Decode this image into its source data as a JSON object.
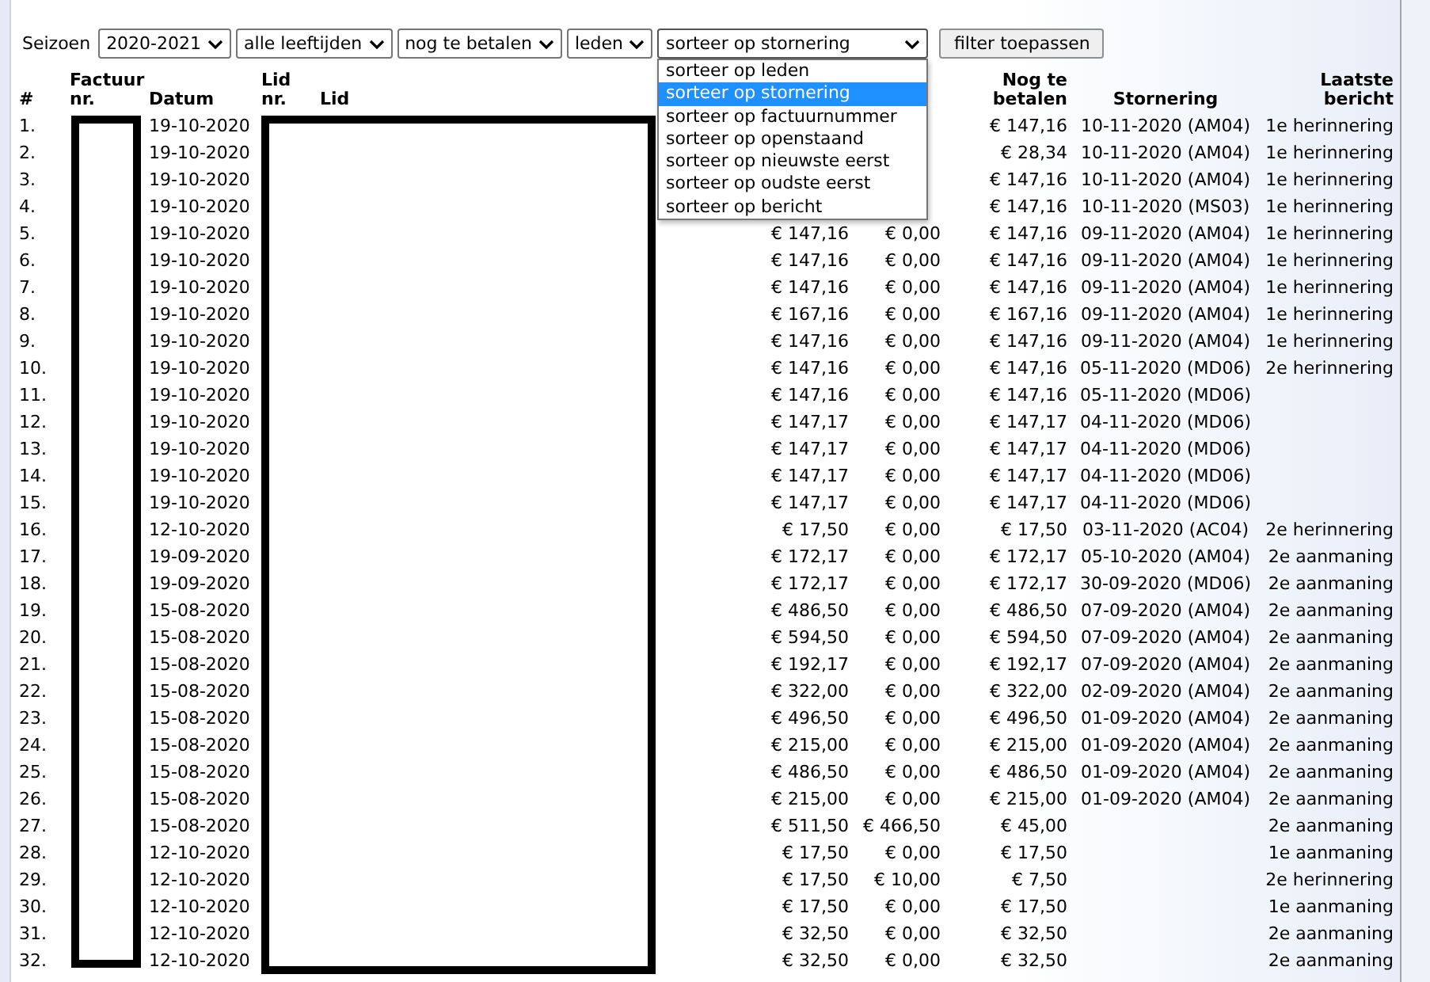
{
  "filters": {
    "label": "Seizoen",
    "selects": [
      {
        "value": "2020-2021"
      },
      {
        "value": "alle leeftijden"
      },
      {
        "value": "nog te betalen"
      },
      {
        "value": "leden"
      }
    ],
    "sort": {
      "value": "sorteer op stornering",
      "expanded": true,
      "options": [
        {
          "label": "sorteer op leden",
          "selected": false
        },
        {
          "label": "sorteer op stornering",
          "selected": true
        },
        {
          "label": "sorteer op factuurnummer",
          "selected": false
        },
        {
          "label": "sorteer op openstaand",
          "selected": false
        },
        {
          "label": "sorteer op nieuwste eerst",
          "selected": false
        },
        {
          "label": "sorteer op oudste eerst",
          "selected": false
        },
        {
          "label": "sorteer op bericht",
          "selected": false
        }
      ]
    },
    "button": "filter toepassen"
  },
  "table": {
    "columns": [
      "#",
      "Factuur nr.",
      "Datum",
      "Lid nr.",
      "Lid",
      "Nog te betalen",
      "Stornering",
      "Laatste bericht"
    ],
    "rows": [
      {
        "n": "1.",
        "date": "19-10-2020",
        "due": "€ 147,16",
        "storno": "10-11-2020 (AM04)",
        "message": "1e herinnering"
      },
      {
        "n": "2.",
        "date": "19-10-2020",
        "due": "€ 28,34",
        "storno": "10-11-2020 (AM04)",
        "message": "1e herinnering"
      },
      {
        "n": "3.",
        "date": "19-10-2020",
        "due": "€ 147,16",
        "storno": "10-11-2020 (AM04)",
        "message": "1e herinnering"
      },
      {
        "n": "4.",
        "date": "19-10-2020",
        "due": "€ 147,16",
        "storno": "10-11-2020 (MS03)",
        "message": "1e herinnering"
      },
      {
        "n": "5.",
        "date": "19-10-2020",
        "amount": "€ 147,16",
        "paid": "€ 0,00",
        "due": "€ 147,16",
        "storno": "09-11-2020 (AM04)",
        "message": "1e herinnering"
      },
      {
        "n": "6.",
        "date": "19-10-2020",
        "amount": "€ 147,16",
        "paid": "€ 0,00",
        "due": "€ 147,16",
        "storno": "09-11-2020 (AM04)",
        "message": "1e herinnering"
      },
      {
        "n": "7.",
        "date": "19-10-2020",
        "amount": "€ 147,16",
        "paid": "€ 0,00",
        "due": "€ 147,16",
        "storno": "09-11-2020 (AM04)",
        "message": "1e herinnering"
      },
      {
        "n": "8.",
        "date": "19-10-2020",
        "amount": "€ 167,16",
        "paid": "€ 0,00",
        "due": "€ 167,16",
        "storno": "09-11-2020 (AM04)",
        "message": "1e herinnering"
      },
      {
        "n": "9.",
        "date": "19-10-2020",
        "amount": "€ 147,16",
        "paid": "€ 0,00",
        "due": "€ 147,16",
        "storno": "09-11-2020 (AM04)",
        "message": "1e herinnering"
      },
      {
        "n": "10.",
        "date": "19-10-2020",
        "amount": "€ 147,16",
        "paid": "€ 0,00",
        "due": "€ 147,16",
        "storno": "05-11-2020 (MD06)",
        "message": "2e herinnering"
      },
      {
        "n": "11.",
        "date": "19-10-2020",
        "amount": "€ 147,16",
        "paid": "€ 0,00",
        "due": "€ 147,16",
        "storno": "05-11-2020 (MD06)"
      },
      {
        "n": "12.",
        "date": "19-10-2020",
        "amount": "€ 147,17",
        "paid": "€ 0,00",
        "due": "€ 147,17",
        "storno": "04-11-2020 (MD06)"
      },
      {
        "n": "13.",
        "date": "19-10-2020",
        "amount": "€ 147,17",
        "paid": "€ 0,00",
        "due": "€ 147,17",
        "storno": "04-11-2020 (MD06)"
      },
      {
        "n": "14.",
        "date": "19-10-2020",
        "amount": "€ 147,17",
        "paid": "€ 0,00",
        "due": "€ 147,17",
        "storno": "04-11-2020 (MD06)"
      },
      {
        "n": "15.",
        "date": "19-10-2020",
        "amount": "€ 147,17",
        "paid": "€ 0,00",
        "due": "€ 147,17",
        "storno": "04-11-2020 (MD06)"
      },
      {
        "n": "16.",
        "date": "12-10-2020",
        "amount": "€ 17,50",
        "paid": "€ 0,00",
        "due": "€ 17,50",
        "storno": "03-11-2020 (AC04)",
        "message": "2e herinnering"
      },
      {
        "n": "17.",
        "date": "19-09-2020",
        "amount": "€ 172,17",
        "paid": "€ 0,00",
        "due": "€ 172,17",
        "storno": "05-10-2020 (AM04)",
        "message": "2e aanmaning"
      },
      {
        "n": "18.",
        "date": "19-09-2020",
        "amount": "€ 172,17",
        "paid": "€ 0,00",
        "due": "€ 172,17",
        "storno": "30-09-2020 (MD06)",
        "message": "2e aanmaning"
      },
      {
        "n": "19.",
        "date": "15-08-2020",
        "amount": "€ 486,50",
        "paid": "€ 0,00",
        "due": "€ 486,50",
        "storno": "07-09-2020 (AM04)",
        "message": "2e aanmaning"
      },
      {
        "n": "20.",
        "date": "15-08-2020",
        "amount": "€ 594,50",
        "paid": "€ 0,00",
        "due": "€ 594,50",
        "storno": "07-09-2020 (AM04)",
        "message": "2e aanmaning"
      },
      {
        "n": "21.",
        "date": "15-08-2020",
        "amount": "€ 192,17",
        "paid": "€ 0,00",
        "due": "€ 192,17",
        "storno": "07-09-2020 (AM04)",
        "message": "2e aanmaning"
      },
      {
        "n": "22.",
        "date": "15-08-2020",
        "amount": "€ 322,00",
        "paid": "€ 0,00",
        "due": "€ 322,00",
        "storno": "02-09-2020 (AM04)",
        "message": "2e aanmaning"
      },
      {
        "n": "23.",
        "date": "15-08-2020",
        "amount": "€ 496,50",
        "paid": "€ 0,00",
        "due": "€ 496,50",
        "storno": "01-09-2020 (AM04)",
        "message": "2e aanmaning"
      },
      {
        "n": "24.",
        "date": "15-08-2020",
        "amount": "€ 215,00",
        "paid": "€ 0,00",
        "due": "€ 215,00",
        "storno": "01-09-2020 (AM04)",
        "message": "2e aanmaning"
      },
      {
        "n": "25.",
        "date": "15-08-2020",
        "amount": "€ 486,50",
        "paid": "€ 0,00",
        "due": "€ 486,50",
        "storno": "01-09-2020 (AM04)",
        "message": "2e aanmaning"
      },
      {
        "n": "26.",
        "date": "15-08-2020",
        "amount": "€ 215,00",
        "paid": "€ 0,00",
        "due": "€ 215,00",
        "storno": "01-09-2020 (AM04)",
        "message": "2e aanmaning"
      },
      {
        "n": "27.",
        "date": "15-08-2020",
        "amount": "€ 511,50",
        "paid": "€ 466,50",
        "due": "€ 45,00",
        "message": "2e aanmaning"
      },
      {
        "n": "28.",
        "date": "12-10-2020",
        "amount": "€ 17,50",
        "paid": "€ 0,00",
        "due": "€ 17,50",
        "message": "1e aanmaning"
      },
      {
        "n": "29.",
        "date": "12-10-2020",
        "amount": "€ 17,50",
        "paid": "€ 10,00",
        "due": "€ 7,50",
        "message": "2e herinnering"
      },
      {
        "n": "30.",
        "date": "12-10-2020",
        "amount": "€ 17,50",
        "paid": "€ 0,00",
        "due": "€ 17,50",
        "message": "1e aanmaning"
      },
      {
        "n": "31.",
        "date": "12-10-2020",
        "amount": "€ 32,50",
        "paid": "€ 0,00",
        "due": "€ 32,50",
        "message": "2e aanmaning"
      },
      {
        "n": "32.",
        "date": "12-10-2020",
        "amount": "€ 32,50",
        "paid": "€ 0,00",
        "due": "€ 32,50",
        "message": "2e aanmaning"
      }
    ]
  }
}
